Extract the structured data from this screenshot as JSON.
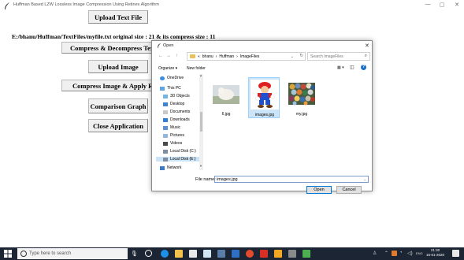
{
  "window": {
    "title": "Huffman Based LZW Lossless Image Compression Using Retinex Algorithm",
    "controls": {
      "minimize": "—",
      "maximize": "▢",
      "close": "✕"
    }
  },
  "buttons": {
    "upload_text": "Upload Text File",
    "compress_text": "Compress & Decompress Text",
    "upload_image": "Upload Image",
    "compress_image": "Compress Image & Apply Retinex",
    "comparison_graph": "Comparison Graph",
    "close_application": "Close Application"
  },
  "result_text": "E:/bhanu/Huffman/TextFiles/myfile.txt original size : 21 & its compress size : 11",
  "dialog": {
    "title": "Open",
    "close": "✕",
    "nav": {
      "back": "←",
      "forward": "→",
      "up": "↑"
    },
    "breadcrumb": [
      "«",
      "bhanu",
      "›",
      "Huffman",
      "›",
      "ImageFiles"
    ],
    "address_dropdown": "⌄",
    "refresh": "↻",
    "search_placeholder": "Search ImageFiles",
    "search_icon": "⌕",
    "organize": "Organize ▾",
    "new_folder": "New folder",
    "view_menu": "▦ ▾",
    "preview_pane": "◫",
    "help": "?",
    "nav_items": [
      "OneDrive",
      "This PC",
      "3D Objects",
      "Desktop",
      "Documents",
      "Downloads",
      "Music",
      "Pictures",
      "Videos",
      "Local Disk (C:)",
      "Local Disk (E:)",
      "Network"
    ],
    "nav_scroll": {
      "up": "▲",
      "down": "▼"
    },
    "files": [
      {
        "name": "6.jpg",
        "selected": false
      },
      {
        "name": "images.jpg",
        "selected": true
      },
      {
        "name": "my.jpg",
        "selected": false
      }
    ],
    "file_name_label": "File name:",
    "file_name_value": "images.jpg",
    "file_name_dropdown": "⌄",
    "open_label": "Open",
    "cancel_label": "Cancel"
  },
  "taskbar": {
    "search_placeholder": "Type here to search",
    "mic": "🎙",
    "tray": [
      "⌃",
      "ENG"
    ],
    "time": "21:30",
    "date": "16-01-2020"
  },
  "colors": {
    "accent": "#0078d7",
    "taskbar": "#1c2533",
    "selection": "#cce4f7"
  }
}
